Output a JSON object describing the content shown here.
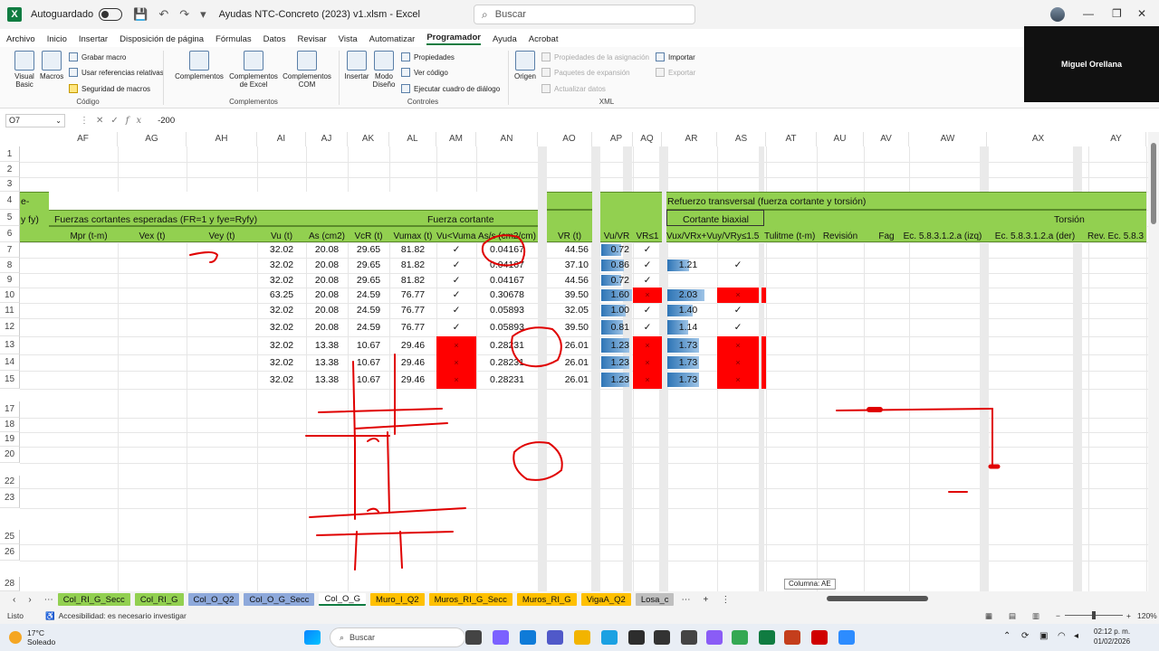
{
  "titlebar": {
    "autosave_label": "Autoguardado",
    "filename": "Ayudas NTC-Concreto (2023) v1.xlsm  -  Excel",
    "search_placeholder": "Buscar"
  },
  "zoom_participant": "Miguel Orellana",
  "menu": [
    "Archivo",
    "Inicio",
    "Insertar",
    "Disposición de página",
    "Fórmulas",
    "Datos",
    "Revisar",
    "Vista",
    "Automatizar",
    "Programador",
    "Ayuda",
    "Acrobat"
  ],
  "menu_active": "Programador",
  "ribbon": {
    "visual_basic": "Visual\nBasic",
    "macros": "Macros",
    "grabar_macro": "Grabar macro",
    "usar_referencias": "Usar referencias relativas",
    "seguridad": "Seguridad de macros",
    "group_codigo": "Código",
    "complementos": "Complementos",
    "complementos_excel": "Complementos de Excel",
    "complementos_com": "Complementos COM",
    "group_complementos": "Complementos",
    "insertar": "Insertar",
    "modo_diseno": "Modo Diseño",
    "propiedades": "Propiedades",
    "ver_codigo": "Ver código",
    "ejecutar_cuadro": "Ejecutar cuadro de diálogo",
    "group_controles": "Controles",
    "origen": "Origen",
    "prop_asignacion": "Propiedades de la asignación",
    "paquetes": "Paquetes de expansión",
    "actualizar": "Actualizar datos",
    "importar": "Importar",
    "exportar": "Exportar",
    "group_xml": "XML"
  },
  "formula_bar": {
    "name_box": "O7",
    "value": "-200"
  },
  "columns": [
    "AF",
    "AG",
    "AH",
    "AI",
    "AJ",
    "AK",
    "AL",
    "AM",
    "AN",
    "AO",
    "AP",
    "AQ",
    "AR",
    "AS",
    "AT",
    "AU",
    "AV",
    "AW",
    "AX",
    "AY"
  ],
  "rows": [
    "1",
    "2",
    "3",
    "4",
    "5",
    "6",
    "7",
    "8",
    "9",
    "10",
    "11",
    "12",
    "13",
    "14",
    "15",
    "17",
    "18",
    "19",
    "20",
    "22",
    "23",
    "25",
    "26",
    "28"
  ],
  "headers": {
    "r4_left": "e-",
    "r4_right": "Refuerzo transversal (fuerza cortante y torsión)",
    "r5_left": "y fy)",
    "r5_fuerzas": "Fuerzas cortantes esperadas (FR=1 y fye=Ryfy)",
    "r5_fuerza_cortante": "Fuerza cortante",
    "r5_cortante_biaxial": "Cortante biaxial",
    "r5_torsion": "Torsión",
    "r6": [
      "Mpr (t-m)",
      "Vex (t)",
      "Vey (t)",
      "Vu (t)",
      "As (cm2)",
      "VcR (t)",
      "Vumax (t)",
      "Vu<Vumax",
      "As/s (cm2/cm)",
      "VR (t)",
      "Vu/VR",
      "VR≤1",
      "Vux/VRx+Vuy/VRy≤1.5",
      "Tulitme (t-m)",
      "Revisión",
      "Fag",
      "Ec. 5.8.3.1.2.a (izq)",
      "Ec. 5.8.3.1.2.a (der)",
      "Rev. Ec. 5.8.3"
    ]
  },
  "table": [
    {
      "row": "7",
      "vu": "32.02",
      "as": "20.08",
      "vcr": "29.65",
      "vumax": "81.82",
      "chk": "✓",
      "ass": "0.04167",
      "vr": "44.56",
      "ratio": "0.72",
      "vr1": "✓",
      "biax": "",
      "biax_chk": ""
    },
    {
      "row": "8",
      "vu": "32.02",
      "as": "20.08",
      "vcr": "29.65",
      "vumax": "81.82",
      "chk": "✓",
      "ass": "0.04167",
      "vr": "37.10",
      "ratio": "0.86",
      "vr1": "✓",
      "biax": "1.21",
      "biax_chk": "✓"
    },
    {
      "row": "9",
      "vu": "32.02",
      "as": "20.08",
      "vcr": "29.65",
      "vumax": "81.82",
      "chk": "✓",
      "ass": "0.04167",
      "vr": "44.56",
      "ratio": "0.72",
      "vr1": "✓",
      "biax": "",
      "biax_chk": ""
    },
    {
      "row": "10",
      "vu": "63.25",
      "as": "20.08",
      "vcr": "24.59",
      "vumax": "76.77",
      "chk": "✓",
      "ass": "0.30678",
      "vr": "39.50",
      "ratio": "1.60",
      "vr1": "×",
      "biax": "2.03",
      "biax_chk": "×"
    },
    {
      "row": "11",
      "vu": "32.02",
      "as": "20.08",
      "vcr": "24.59",
      "vumax": "76.77",
      "chk": "✓",
      "ass": "0.05893",
      "vr": "32.05",
      "ratio": "1.00",
      "vr1": "✓",
      "biax": "1.40",
      "biax_chk": "✓"
    },
    {
      "row": "12",
      "vu": "32.02",
      "as": "20.08",
      "vcr": "24.59",
      "vumax": "76.77",
      "chk": "✓",
      "ass": "0.05893",
      "vr": "39.50",
      "ratio": "0.81",
      "vr1": "✓",
      "biax": "1.14",
      "biax_chk": "✓"
    },
    {
      "row": "13",
      "vu": "32.02",
      "as": "13.38",
      "vcr": "10.67",
      "vumax": "29.46",
      "chk": "×",
      "ass": "0.28231",
      "vr": "26.01",
      "ratio": "1.23",
      "vr1": "×",
      "biax": "1.73",
      "biax_chk": "×"
    },
    {
      "row": "14",
      "vu": "32.02",
      "as": "13.38",
      "vcr": "10.67",
      "vumax": "29.46",
      "chk": "×",
      "ass": "0.28231",
      "vr": "26.01",
      "ratio": "1.23",
      "vr1": "×",
      "biax": "1.73",
      "biax_chk": "×"
    },
    {
      "row": "15",
      "vu": "32.02",
      "as": "13.38",
      "vcr": "10.67",
      "vumax": "29.46",
      "chk": "×",
      "ass": "0.28231",
      "vr": "26.01",
      "ratio": "1.23",
      "vr1": "×",
      "biax": "1.73",
      "biax_chk": "×"
    }
  ],
  "sheet_tabs": [
    {
      "label": "Col_RI_G_Secc",
      "color": "#92d050"
    },
    {
      "label": "Col_RI_G",
      "color": "#92d050"
    },
    {
      "label": "Col_O_Q2",
      "color": "#8ea9db"
    },
    {
      "label": "Col_O_G_Secc",
      "color": "#8ea9db"
    },
    {
      "label": "Col_O_G",
      "color": "#ffffff"
    },
    {
      "label": "Muro_I_Q2",
      "color": "#ffc000"
    },
    {
      "label": "Muros_RI_G_Secc",
      "color": "#ffc000"
    },
    {
      "label": "Muros_RI_G",
      "color": "#ffc000"
    },
    {
      "label": "VigaA_Q2",
      "color": "#ffc000"
    },
    {
      "label": "Losa_c",
      "color": "#bfbfbf"
    }
  ],
  "column_tooltip": "Columna: AE",
  "status": {
    "ready": "Listo",
    "accessibility": "Accesibilidad: es necesario investigar",
    "zoom": "120%"
  },
  "taskbar": {
    "temp": "17°C",
    "weather": "Soleado",
    "search": "Buscar",
    "time": "02:12 p. m.",
    "date": "01/02/2026"
  },
  "colors": {
    "green_header": "#92d050",
    "fail_red": "#ff0000",
    "bar_blue": "#2e75b6",
    "ink_red": "#e00000"
  }
}
